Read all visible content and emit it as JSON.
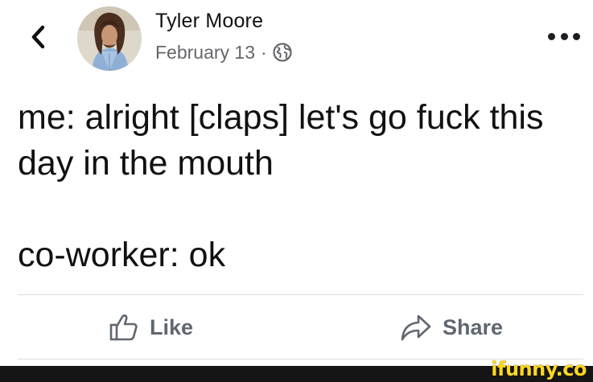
{
  "nav": {
    "back_icon": "chevron-left-icon"
  },
  "post": {
    "author": "Tyler Moore",
    "date": "February 13",
    "separator": "·",
    "privacy_icon": "globe-icon",
    "more_icon": "more-dots-icon",
    "lines": [
      "me: alright [claps] let's go fuck this",
      "day in the mouth",
      "co-worker: ok"
    ]
  },
  "actions": {
    "like_label": "Like",
    "like_icon": "thumbs-up-icon",
    "share_label": "Share",
    "share_icon": "share-arrow-icon"
  },
  "watermark": {
    "text": "ifunny.co"
  },
  "colors": {
    "text": "#111111",
    "muted": "#65676b",
    "action": "#606770",
    "divider": "#dadde1",
    "watermark": "#ffd71c",
    "footer": "#151515"
  }
}
